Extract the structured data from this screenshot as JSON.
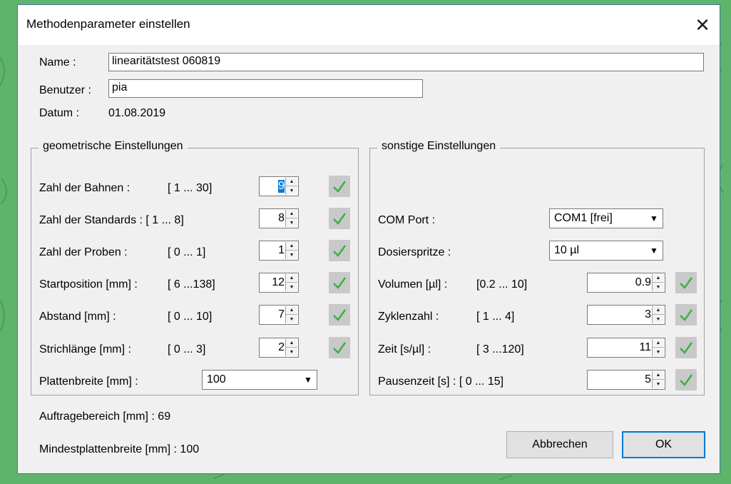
{
  "dialog": {
    "title": "Methodenparameter einstellen",
    "close_glyph": "✕"
  },
  "general": {
    "name_label": "Name :",
    "name_value": "linearitätstest 060819",
    "user_label": "Benutzer :",
    "user_value": "pia",
    "date_label": "Datum :",
    "date_value": "01.08.2019"
  },
  "geo": {
    "legend": "geometrische Einstellungen",
    "rows": [
      {
        "label": "Zahl der Bahnen :",
        "range": "[ 1  ... 30]",
        "value": "9"
      },
      {
        "label": "Zahl der Standards : [ 1  ...  8]",
        "range": "",
        "value": "8"
      },
      {
        "label": "Zahl der Proben :",
        "range": "[ 0  ...  1]",
        "value": "1"
      },
      {
        "label": "Startposition [mm] :",
        "range": "[ 6  ...138]",
        "value": "12"
      },
      {
        "label": "Abstand [mm] :",
        "range": "[ 0  ... 10]",
        "value": "7"
      },
      {
        "label": "Strichlänge [mm] :",
        "range": "[ 0  ...  3]",
        "value": "2"
      }
    ],
    "plate_label": "Plattenbreite  [mm] :",
    "plate_value": "100"
  },
  "other": {
    "legend": "sonstige Einstellungen",
    "com_label": "COM Port :",
    "com_value": "COM1 [frei]",
    "syringe_label": "Dosierspritze :",
    "syringe_value": "10 µl",
    "rows": [
      {
        "label": "Volumen [µl] :",
        "range": "[0.2   ... 10]",
        "value": "0.9"
      },
      {
        "label": "Zyklenzahl :",
        "range": "[ 1     ...  4]",
        "value": "3"
      },
      {
        "label": "Zeit [s/µl] :",
        "range": "[ 3     ...120]",
        "value": "11"
      },
      {
        "label": "Pausenzeit [s] : [ 0     ... 15]",
        "range": "",
        "value": "5"
      }
    ]
  },
  "footer": {
    "area_text": "Auftragebereich [mm] : 69",
    "minwidth_text": "Mindestplattenbreite [mm] : 100",
    "cancel_label": "Abbrechen",
    "ok_label": "OK"
  },
  "colors": {
    "check": "#3cb043",
    "selection": "#0078d7",
    "background": "#5fb46c"
  }
}
